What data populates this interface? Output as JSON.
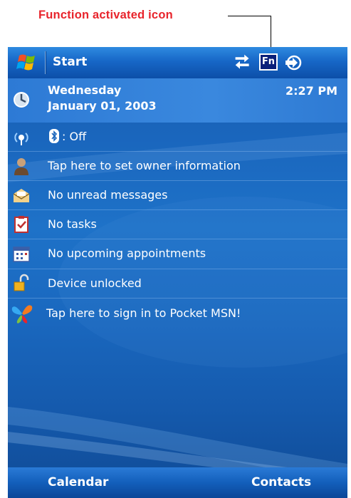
{
  "callout": {
    "label": "Function activated icon"
  },
  "titlebar": {
    "title": "Start",
    "fn_label": "Fn",
    "icons": [
      "windows-start-icon",
      "sync-arrows-icon",
      "fn-key-icon",
      "connectivity-icon"
    ]
  },
  "today": {
    "day": "Wednesday",
    "date": "January 01, 2003",
    "time": "2:27 PM",
    "items": [
      {
        "icon": "wireless-icon",
        "label": "🔷",
        "bluetooth_state": ": Off"
      },
      {
        "icon": "owner-icon",
        "label": "Tap here to set owner information"
      },
      {
        "icon": "messages-icon",
        "label": "No unread messages"
      },
      {
        "icon": "tasks-icon",
        "label": "No tasks"
      },
      {
        "icon": "calendar-icon",
        "label": "No upcoming appointments"
      },
      {
        "icon": "lock-icon",
        "label": "Device unlocked"
      },
      {
        "icon": "msn-butterfly-icon",
        "label": "Tap here to sign in to Pocket MSN!"
      }
    ]
  },
  "softkeys": {
    "left": "Calendar",
    "right": "Contacts"
  },
  "colors": {
    "callout_red": "#e8242c",
    "screen_blue": "#1a66bd"
  }
}
